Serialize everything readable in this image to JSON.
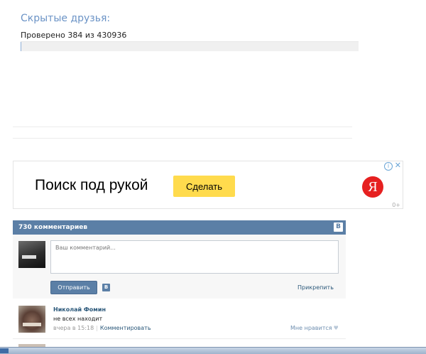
{
  "hidden_friends": {
    "title": "Скрытые друзья:",
    "checked_text": "Проверено 384 из 430936",
    "progress_fraction": 0.0009
  },
  "ad": {
    "text": "Поиск под рукой",
    "button_label": "Сделать",
    "logo_letter": "Я",
    "info_glyph": "i",
    "close_glyph": "✕",
    "corner_mark": "0+"
  },
  "comments_widget": {
    "header": "730 комментариев",
    "vk_badge": "В",
    "input": {
      "placeholder": "Ваш комментарий...",
      "value": ""
    },
    "submit_label": "Отправить",
    "small_vk": "В",
    "attach_label": "Прикрепить"
  },
  "comments": [
    {
      "author": "Николай Фомин",
      "text": "не всех находит",
      "time": "вчера в 15:18",
      "separator": "|",
      "reply_label": "Комментировать",
      "like_label": "Мне нравится",
      "like_icon": "♥"
    }
  ],
  "colors": {
    "accent": "#5b7fa6",
    "title_blue": "#6b93c6",
    "link": "#2b587a",
    "ad_button": "#ffdb4d",
    "ad_logo": "#e62020"
  }
}
